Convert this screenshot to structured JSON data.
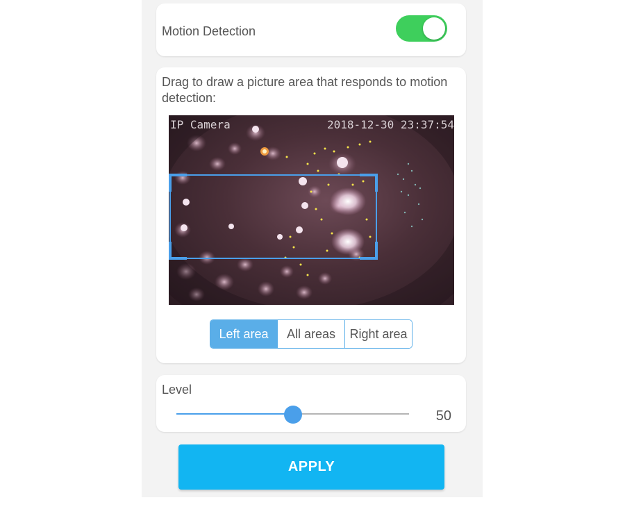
{
  "motion": {
    "label": "Motion Detection",
    "enabled": true,
    "toggle_color": "#3ecf5c"
  },
  "area": {
    "instruction": "Drag to draw a picture area that responds to motion detection:",
    "camera_label": "IP Camera",
    "timestamp": "2018-12-30 23:37:54",
    "segments": [
      "Left area",
      "All areas",
      "Right area"
    ],
    "selected_segment": "Left area",
    "accent_color": "#4a9fea"
  },
  "level": {
    "label": "Level",
    "value": "50",
    "fraction": 0.5
  },
  "apply": {
    "label": "APPLY",
    "color": "#12b5f2"
  }
}
